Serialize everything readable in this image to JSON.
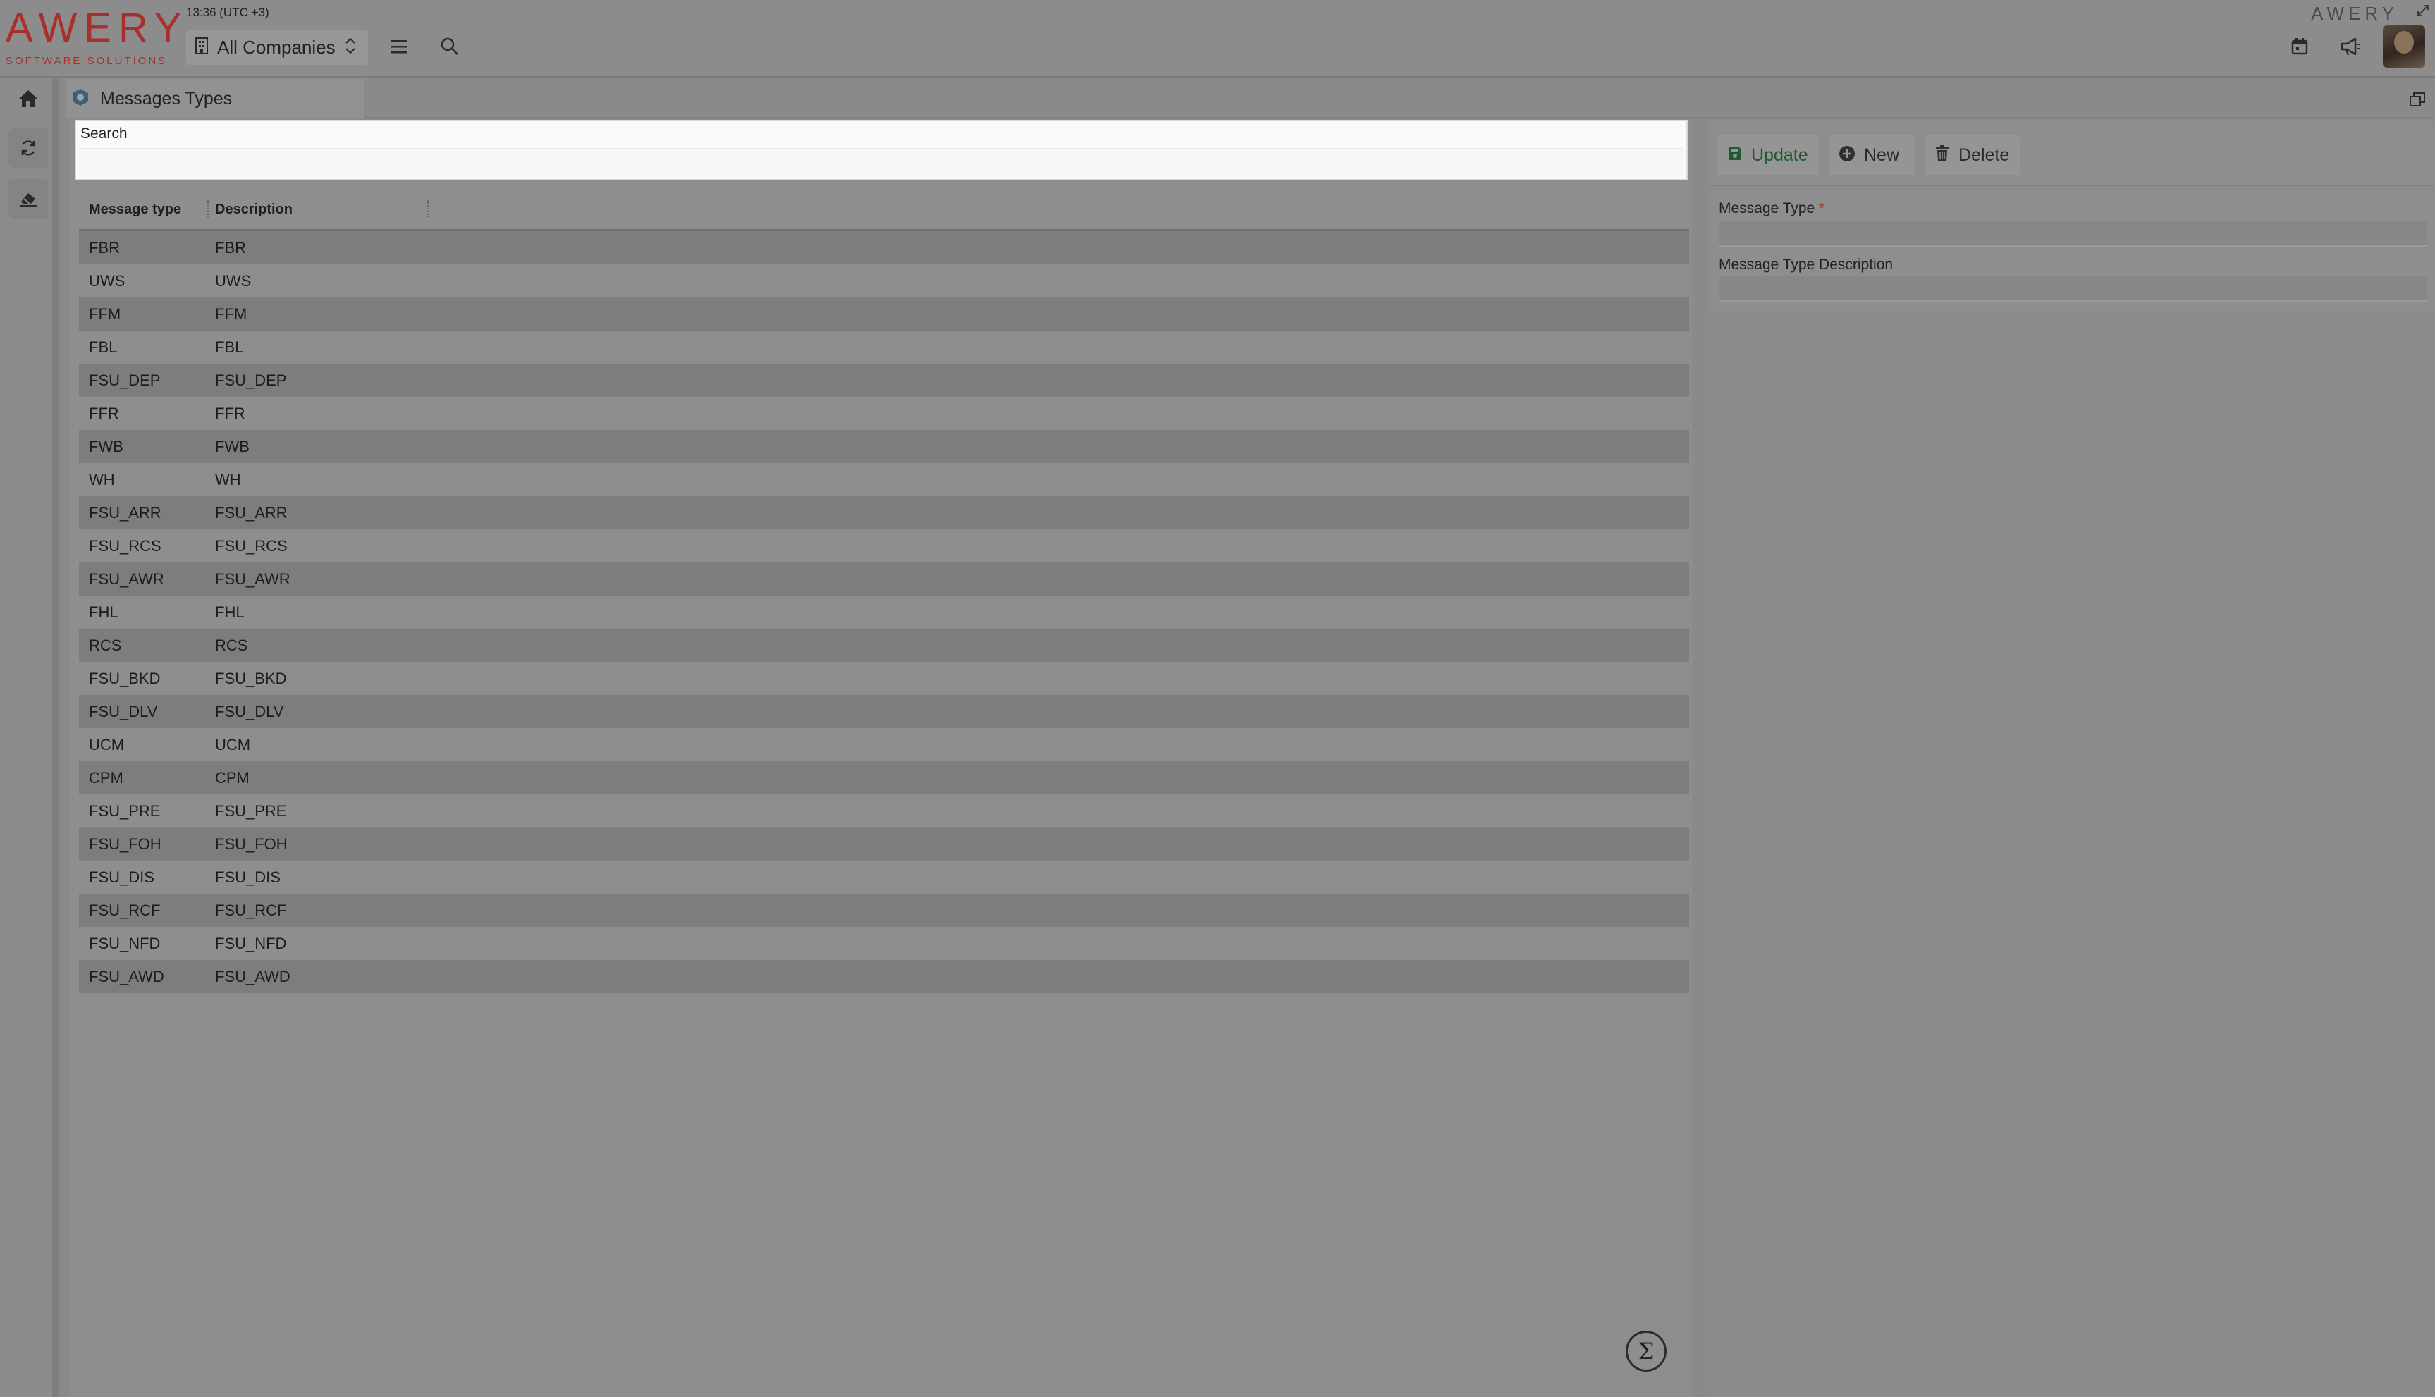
{
  "header": {
    "logo_text": "AWERY",
    "logo_sub": "SOFTWARE SOLUTIONS",
    "clock": "13:36 (UTC +3)",
    "company_label": "All Companies",
    "brand_right": "AWERY"
  },
  "tab": {
    "title": "Messages Types"
  },
  "search": {
    "label": "Search",
    "value": ""
  },
  "grid": {
    "columns": [
      "Message type",
      "Description"
    ],
    "rows": [
      [
        "FBR",
        "FBR"
      ],
      [
        "UWS",
        "UWS"
      ],
      [
        "FFM",
        "FFM"
      ],
      [
        "FBL",
        "FBL"
      ],
      [
        "FSU_DEP",
        "FSU_DEP"
      ],
      [
        "FFR",
        "FFR"
      ],
      [
        "FWB",
        "FWB"
      ],
      [
        "WH",
        "WH"
      ],
      [
        "FSU_ARR",
        "FSU_ARR"
      ],
      [
        "FSU_RCS",
        "FSU_RCS"
      ],
      [
        "FSU_AWR",
        "FSU_AWR"
      ],
      [
        "FHL",
        "FHL"
      ],
      [
        "RCS",
        "RCS"
      ],
      [
        "FSU_BKD",
        "FSU_BKD"
      ],
      [
        "FSU_DLV",
        "FSU_DLV"
      ],
      [
        "UCM",
        "UCM"
      ],
      [
        "CPM",
        "CPM"
      ],
      [
        "FSU_PRE",
        "FSU_PRE"
      ],
      [
        "FSU_FOH",
        "FSU_FOH"
      ],
      [
        "FSU_DIS",
        "FSU_DIS"
      ],
      [
        "FSU_RCF",
        "FSU_RCF"
      ],
      [
        "FSU_NFD",
        "FSU_NFD"
      ],
      [
        "FSU_AWD",
        "FSU_AWD"
      ]
    ]
  },
  "toolbar": {
    "update_label": "Update",
    "new_label": "New",
    "delete_label": "Delete"
  },
  "form": {
    "message_type_label": "Message Type",
    "required_mark": "*",
    "message_type_value": "",
    "description_label": "Message Type Description",
    "description_value": ""
  },
  "footer": {
    "sigma_symbol": "Σ"
  },
  "colors": {
    "brand": "#a8302c",
    "update_accent": "#1f5a30",
    "required": "#b22a20"
  }
}
